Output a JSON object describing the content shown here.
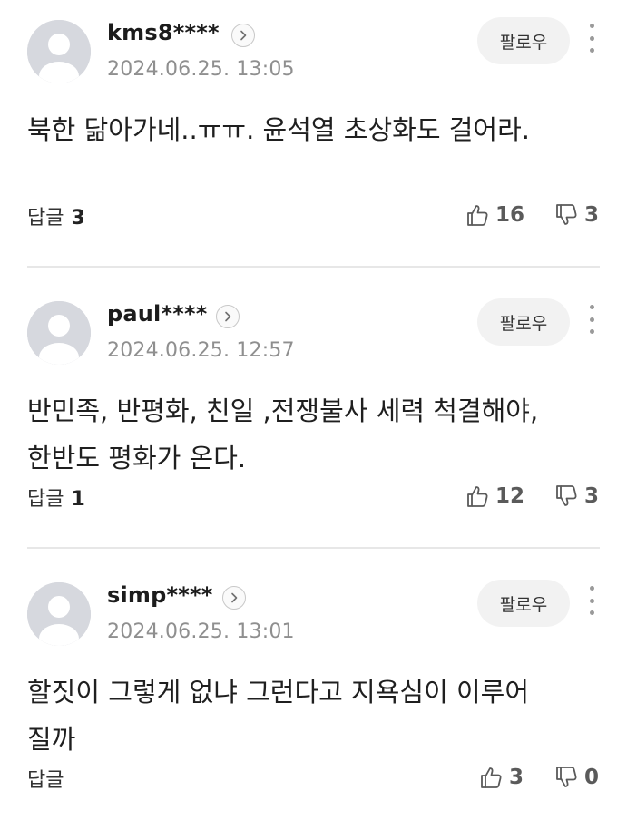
{
  "follow_label": "팔로우",
  "reply_label": "답글",
  "icons": {
    "avatar": "default-profile-avatar",
    "profile_link": "chevron-right-icon",
    "more": "vertical-dots-icon",
    "like": "thumbs-up-icon",
    "dislike": "thumbs-down-icon"
  },
  "colors": {
    "avatar_bg": "#d6d8de",
    "follow_bg": "#f2f2f2",
    "timestamp": "#8f8f8f",
    "divider": "#e7e7e7"
  },
  "comments": [
    {
      "username": "kms8****",
      "timestamp": "2024.06.25. 13:05",
      "body": "북한 닮아가네..ㅠㅠ. 윤석열 초상화도 걸어라.",
      "reply_count": "3",
      "likes": "16",
      "dislikes": "3"
    },
    {
      "username": "paul****",
      "timestamp": "2024.06.25. 12:57",
      "body": "반민족, 반평화, 친일 ,전쟁불사 세력 척결해야, 한반도 평화가 온다.",
      "reply_count": "1",
      "likes": "12",
      "dislikes": "3"
    },
    {
      "username": "simp****",
      "timestamp": "2024.06.25. 13:01",
      "body": "할짓이 그렇게 없냐 그런다고 지욕심이 이루어 질까",
      "reply_count": "",
      "likes": "3",
      "dislikes": "0"
    }
  ]
}
